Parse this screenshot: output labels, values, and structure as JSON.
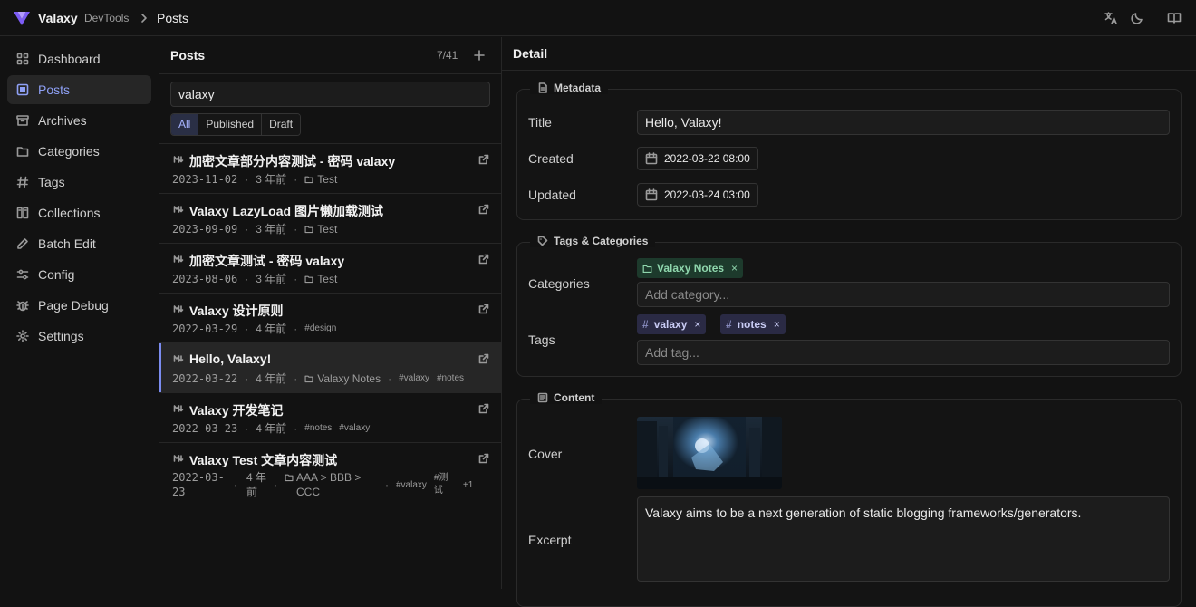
{
  "app": {
    "brand": "Valaxy",
    "subtitle": "DevTools",
    "breadcrumb": "Posts"
  },
  "sidebar": {
    "items": [
      {
        "label": "Dashboard",
        "icon": "dashboard-icon"
      },
      {
        "label": "Posts",
        "icon": "posts-icon",
        "active": true
      },
      {
        "label": "Archives",
        "icon": "archive-icon"
      },
      {
        "label": "Categories",
        "icon": "folder-icon"
      },
      {
        "label": "Tags",
        "icon": "hash-icon"
      },
      {
        "label": "Collections",
        "icon": "collections-icon"
      },
      {
        "label": "Batch Edit",
        "icon": "pencil-icon"
      },
      {
        "label": "Config",
        "icon": "sliders-icon"
      },
      {
        "label": "Page Debug",
        "icon": "bug-icon"
      },
      {
        "label": "Settings",
        "icon": "gear-icon"
      }
    ]
  },
  "posts": {
    "title": "Posts",
    "count": "7/41",
    "search_value": "valaxy",
    "filters": [
      "All",
      "Published",
      "Draft"
    ],
    "active_filter": "All",
    "items": [
      {
        "title": "加密文章部分内容测试 - 密码 valaxy",
        "date": "2023-11-02",
        "ago": "3 年前",
        "category": "Test",
        "tags": []
      },
      {
        "title": "Valaxy LazyLoad 图片懒加载测试",
        "date": "2023-09-09",
        "ago": "3 年前",
        "category": "Test",
        "tags": []
      },
      {
        "title": "加密文章测试 - 密码 valaxy",
        "date": "2023-08-06",
        "ago": "3 年前",
        "category": "Test",
        "tags": []
      },
      {
        "title": "Valaxy 设计原则",
        "date": "2022-03-29",
        "ago": "4 年前",
        "category": "",
        "tags": [
          "#design"
        ]
      },
      {
        "title": "Hello, Valaxy!",
        "date": "2022-03-22",
        "ago": "4 年前",
        "category": "Valaxy Notes",
        "tags": [
          "#valaxy",
          "#notes"
        ],
        "selected": true
      },
      {
        "title": "Valaxy 开发笔记",
        "date": "2022-03-23",
        "ago": "4 年前",
        "category": "",
        "tags": [
          "#notes",
          "#valaxy"
        ]
      },
      {
        "title": "Valaxy Test 文章内容测试",
        "date": "2022-03-23",
        "ago": "4 年前",
        "category": "AAA > BBB > CCC",
        "tags": [
          "#valaxy",
          "#测试"
        ],
        "more": "+1"
      }
    ]
  },
  "detail": {
    "title": "Detail",
    "metadata": {
      "legend": "Metadata",
      "title_label": "Title",
      "title_value": "Hello, Valaxy!",
      "created_label": "Created",
      "created_value": "2022-03-22 08:00",
      "updated_label": "Updated",
      "updated_value": "2022-03-24 03:00"
    },
    "taxonomy": {
      "legend": "Tags & Categories",
      "categories_label": "Categories",
      "categories": [
        "Valaxy Notes"
      ],
      "category_placeholder": "Add category...",
      "tags_label": "Tags",
      "tags": [
        "valaxy",
        "notes"
      ],
      "tag_placeholder": "Add tag...",
      "remove_symbol": "×"
    },
    "content": {
      "legend": "Content",
      "cover_label": "Cover",
      "excerpt_label": "Excerpt",
      "excerpt_value": "Valaxy aims to be a next generation of static blogging frameworks/generators."
    }
  },
  "colors": {
    "accent": "#8ea0f5",
    "category_chip": "#1d3a2c",
    "tag_chip": "#2a2a44",
    "background": "#121212"
  }
}
